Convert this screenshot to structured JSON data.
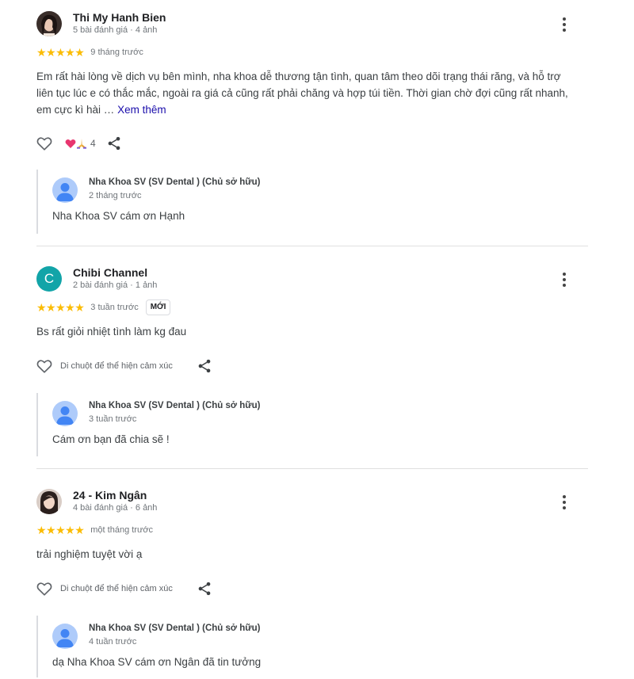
{
  "reviews": [
    {
      "author": "Thi My Hanh Bien",
      "author_meta": "5 bài đánh giá · 4 ảnh",
      "stars": "★★★★★",
      "rating": 5,
      "time": "9 tháng trước",
      "text": "Em rất hài lòng về dịch vụ bên mình, nha khoa dễ thương tận tình, quan tâm theo dõi trạng thái răng, và hỗ trợ liên tục lúc e có thắc mắc, ngoài ra giá cả cũng rất phải chăng và hợp túi tiền. Thời gian chờ đợi cũng rất nhanh, em cực kì hài … ",
      "more_label": "Xem thêm",
      "reaction_count": "4",
      "reply": {
        "owner": "Nha Khoa SV (SV Dental ) (Chủ sở hữu)",
        "time": "2 tháng trước",
        "text": "Nha Khoa SV cám ơn Hạnh"
      }
    },
    {
      "author": "Chibi Channel",
      "avatar_letter": "C",
      "author_meta": "2 bài đánh giá · 1 ảnh",
      "stars": "★★★★★",
      "rating": 5,
      "time": "3 tuần trước",
      "badge": "MỚI",
      "text": "Bs rất giỏi nhiệt tình làm kg đau",
      "hover_text": "Di chuột để thể hiện cảm xúc",
      "reply": {
        "owner": "Nha Khoa SV (SV Dental ) (Chủ sở hữu)",
        "time": "3 tuần trước",
        "text": "Cám ơn bạn đã chia sẽ !"
      }
    },
    {
      "author": "24 - Kim Ngân",
      "author_meta": "4 bài đánh giá · 6 ảnh",
      "stars": "★★★★★",
      "rating": 5,
      "time": "một tháng trước",
      "text": "trải nghiệm tuyệt vời ạ",
      "hover_text": "Di chuột để thể hiện cảm xúc",
      "reply": {
        "owner": "Nha Khoa SV (SV Dental ) (Chủ sở hữu)",
        "time": "4 tuần trước",
        "text": "dạ Nha Khoa SV cám ơn Ngân đã tin tưởng"
      }
    }
  ],
  "colors": {
    "star": "#fbbc04",
    "link": "#1a0dab",
    "owner_avatar": "#aecbfa",
    "letter_avatar": "#12a4a8"
  },
  "icons": [
    "user-photo-avatar",
    "kebab-menu-icon",
    "heart-outline-icon",
    "heart-reaction-icon",
    "pray-hands-reaction-icon",
    "share-icon",
    "owner-person-avatar-icon"
  ]
}
